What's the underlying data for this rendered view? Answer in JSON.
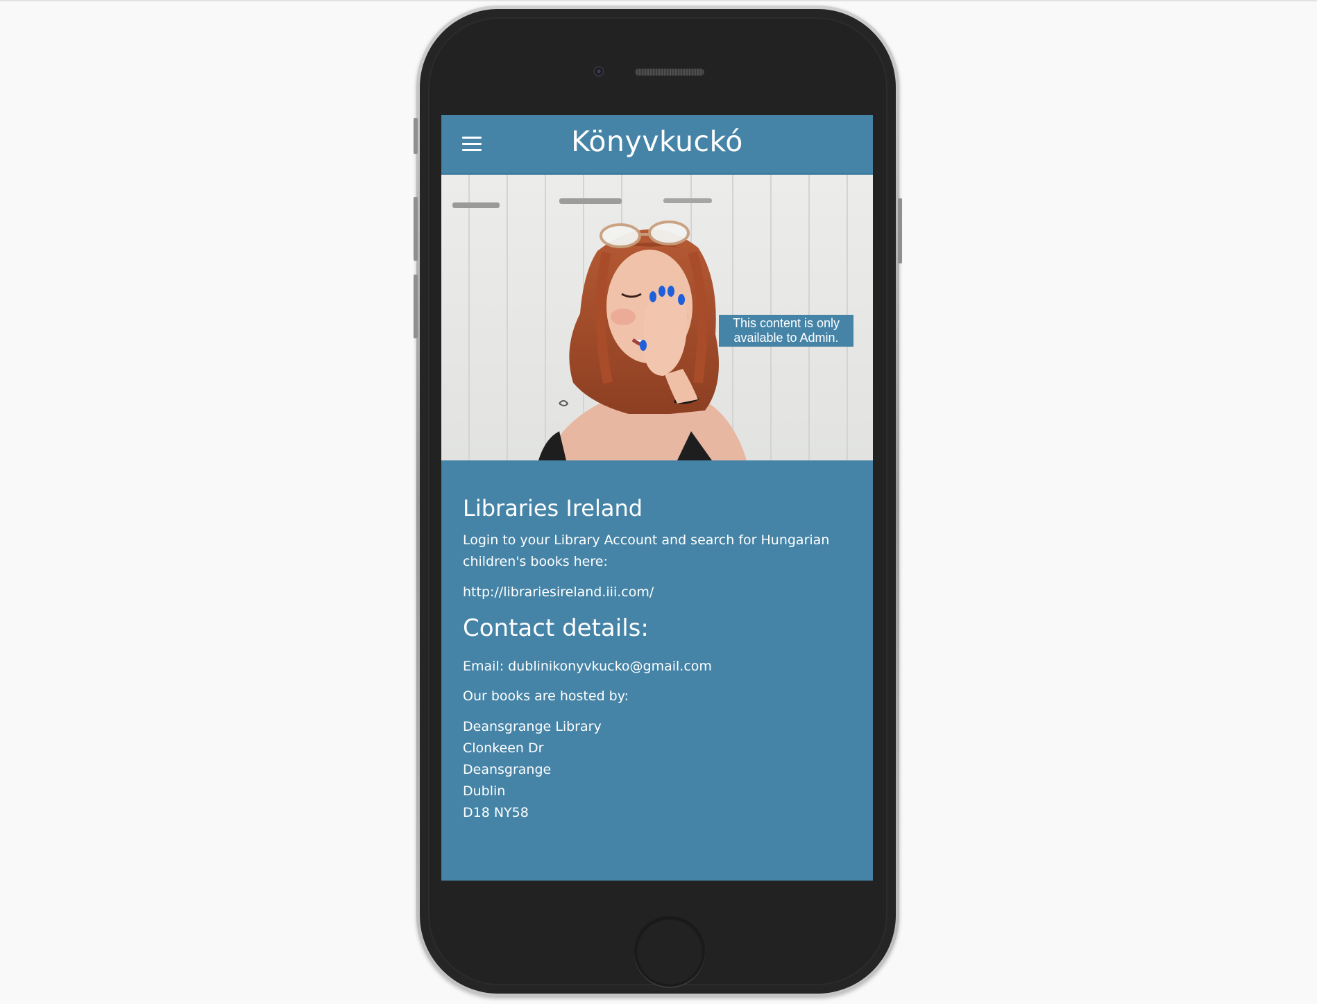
{
  "header": {
    "title": "Könyvkuckó",
    "menu_icon": "hamburger-menu-icon"
  },
  "hero": {
    "admin_notice": "This content is only available to Admin."
  },
  "libraries": {
    "heading": "Libraries Ireland",
    "intro_line1": "Login to your Library Account and search for Hungarian",
    "intro_line2": "children's books here:",
    "link": "http://librariesireland.iii.com/"
  },
  "contact": {
    "heading": "Contact details:",
    "email": "Email: dublinikonyvkucko@gmail.com",
    "hosted_by": "Our books are hosted by:",
    "address": [
      "Deansgrange Library",
      "Clonkeen Dr",
      "Deansgrange",
      "Dublin",
      "D18 NY58"
    ]
  },
  "colors": {
    "brand": "#4584a7",
    "text": "#ffffff",
    "phone_body": "#222222"
  }
}
